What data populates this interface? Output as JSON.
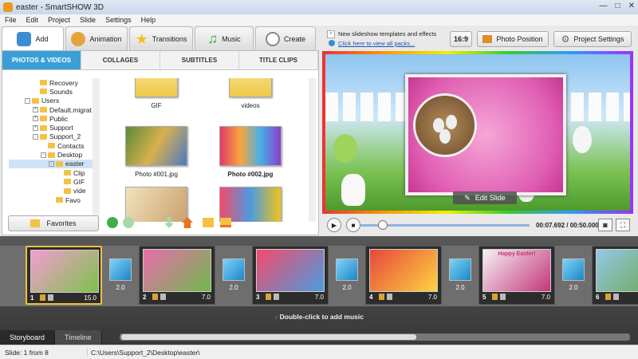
{
  "window": {
    "title": "easter - SmartSHOW 3D",
    "minimize": "—",
    "maximize": "□",
    "close": "✕"
  },
  "menu": [
    "File",
    "Edit",
    "Project",
    "Slide",
    "Settings",
    "Help"
  ],
  "tabs": [
    {
      "label": "Add",
      "icon": "camera-icon",
      "color": "#3b8ed1"
    },
    {
      "label": "Animation",
      "icon": "palette-icon",
      "color": "#e5a33a"
    },
    {
      "label": "Transitions",
      "icon": "star-icon",
      "color": "#f1c319"
    },
    {
      "label": "Music",
      "icon": "music-note-icon",
      "color": "#3aa648"
    },
    {
      "label": "Create",
      "icon": "film-reel-icon",
      "color": "#888888"
    }
  ],
  "subtabs": [
    "PHOTOS & VIDEOS",
    "COLLAGES",
    "SUBTITLES",
    "TITLE CLIPS"
  ],
  "tree": [
    {
      "label": "Recovery",
      "indent": 1,
      "pm": ""
    },
    {
      "label": "Sounds",
      "indent": 1,
      "pm": ""
    },
    {
      "label": "Users",
      "indent": 0,
      "pm": "-"
    },
    {
      "label": "Default.migrat",
      "indent": 1,
      "pm": "+"
    },
    {
      "label": "Public",
      "indent": 1,
      "pm": "+"
    },
    {
      "label": "Support",
      "indent": 1,
      "pm": "+"
    },
    {
      "label": "Support_2",
      "indent": 1,
      "pm": "-"
    },
    {
      "label": "Contacts",
      "indent": 2,
      "pm": ""
    },
    {
      "label": "Desktop",
      "indent": 2,
      "pm": "-"
    },
    {
      "label": "easter",
      "indent": 3,
      "pm": "-",
      "selected": true
    },
    {
      "label": "Clip",
      "indent": 4,
      "pm": ""
    },
    {
      "label": "GIF",
      "indent": 4,
      "pm": ""
    },
    {
      "label": "vide",
      "indent": 4,
      "pm": ""
    },
    {
      "label": "Favo",
      "indent": 3,
      "pm": ""
    }
  ],
  "files": [
    {
      "label": "GIF",
      "bold": false
    },
    {
      "label": "videos",
      "bold": false
    },
    {
      "label": "Photo #001.jpg",
      "bold": false
    },
    {
      "label": "Photo #002.jpg",
      "bold": true
    },
    {
      "label": "",
      "bold": false
    },
    {
      "label": "",
      "bold": false
    }
  ],
  "favorites": "Favorites",
  "news": {
    "line1": "New slideshow templates and effects",
    "line2": "Click here to view all packs..."
  },
  "aspect": "16:9",
  "photo_position": "Photo Position",
  "project_settings": "Project Settings",
  "edit_slide": "Edit Slide",
  "player": {
    "time": "00:07.692 / 00:50.000",
    "progress_fraction": 0.13
  },
  "slides": [
    {
      "num": "1",
      "dur": "15.0",
      "active": true,
      "colors": [
        "#f59cd4",
        "#7cc24a"
      ]
    },
    {
      "num": "2",
      "dur": "7.0",
      "active": false,
      "colors": [
        "#e86cae",
        "#70b84c"
      ]
    },
    {
      "num": "3",
      "dur": "7.0",
      "active": false,
      "colors": [
        "#f44b6b",
        "#4b9be0"
      ]
    },
    {
      "num": "4",
      "dur": "7.0",
      "active": false,
      "colors": [
        "#e6473c",
        "#ffd240"
      ]
    },
    {
      "num": "5",
      "dur": "7.0",
      "active": false,
      "colors": [
        "#f3f3f3",
        "#c6347a"
      ]
    },
    {
      "num": "6",
      "dur": "",
      "active": false,
      "colors": [
        "#93c8e8",
        "#6da64a"
      ]
    }
  ],
  "slide_texts": {
    "s5": "Happy Easter!"
  },
  "transitions": [
    "2.0",
    "2.0",
    "2.0",
    "2.0",
    "2.0"
  ],
  "music_hint": "Double-click to add music",
  "bottom_tabs": [
    "Storyboard",
    "Timeline"
  ],
  "status": {
    "slide": "Slide: 1 from 8",
    "path": "C:\\Users\\Support_2\\Desktop\\easter\\"
  }
}
